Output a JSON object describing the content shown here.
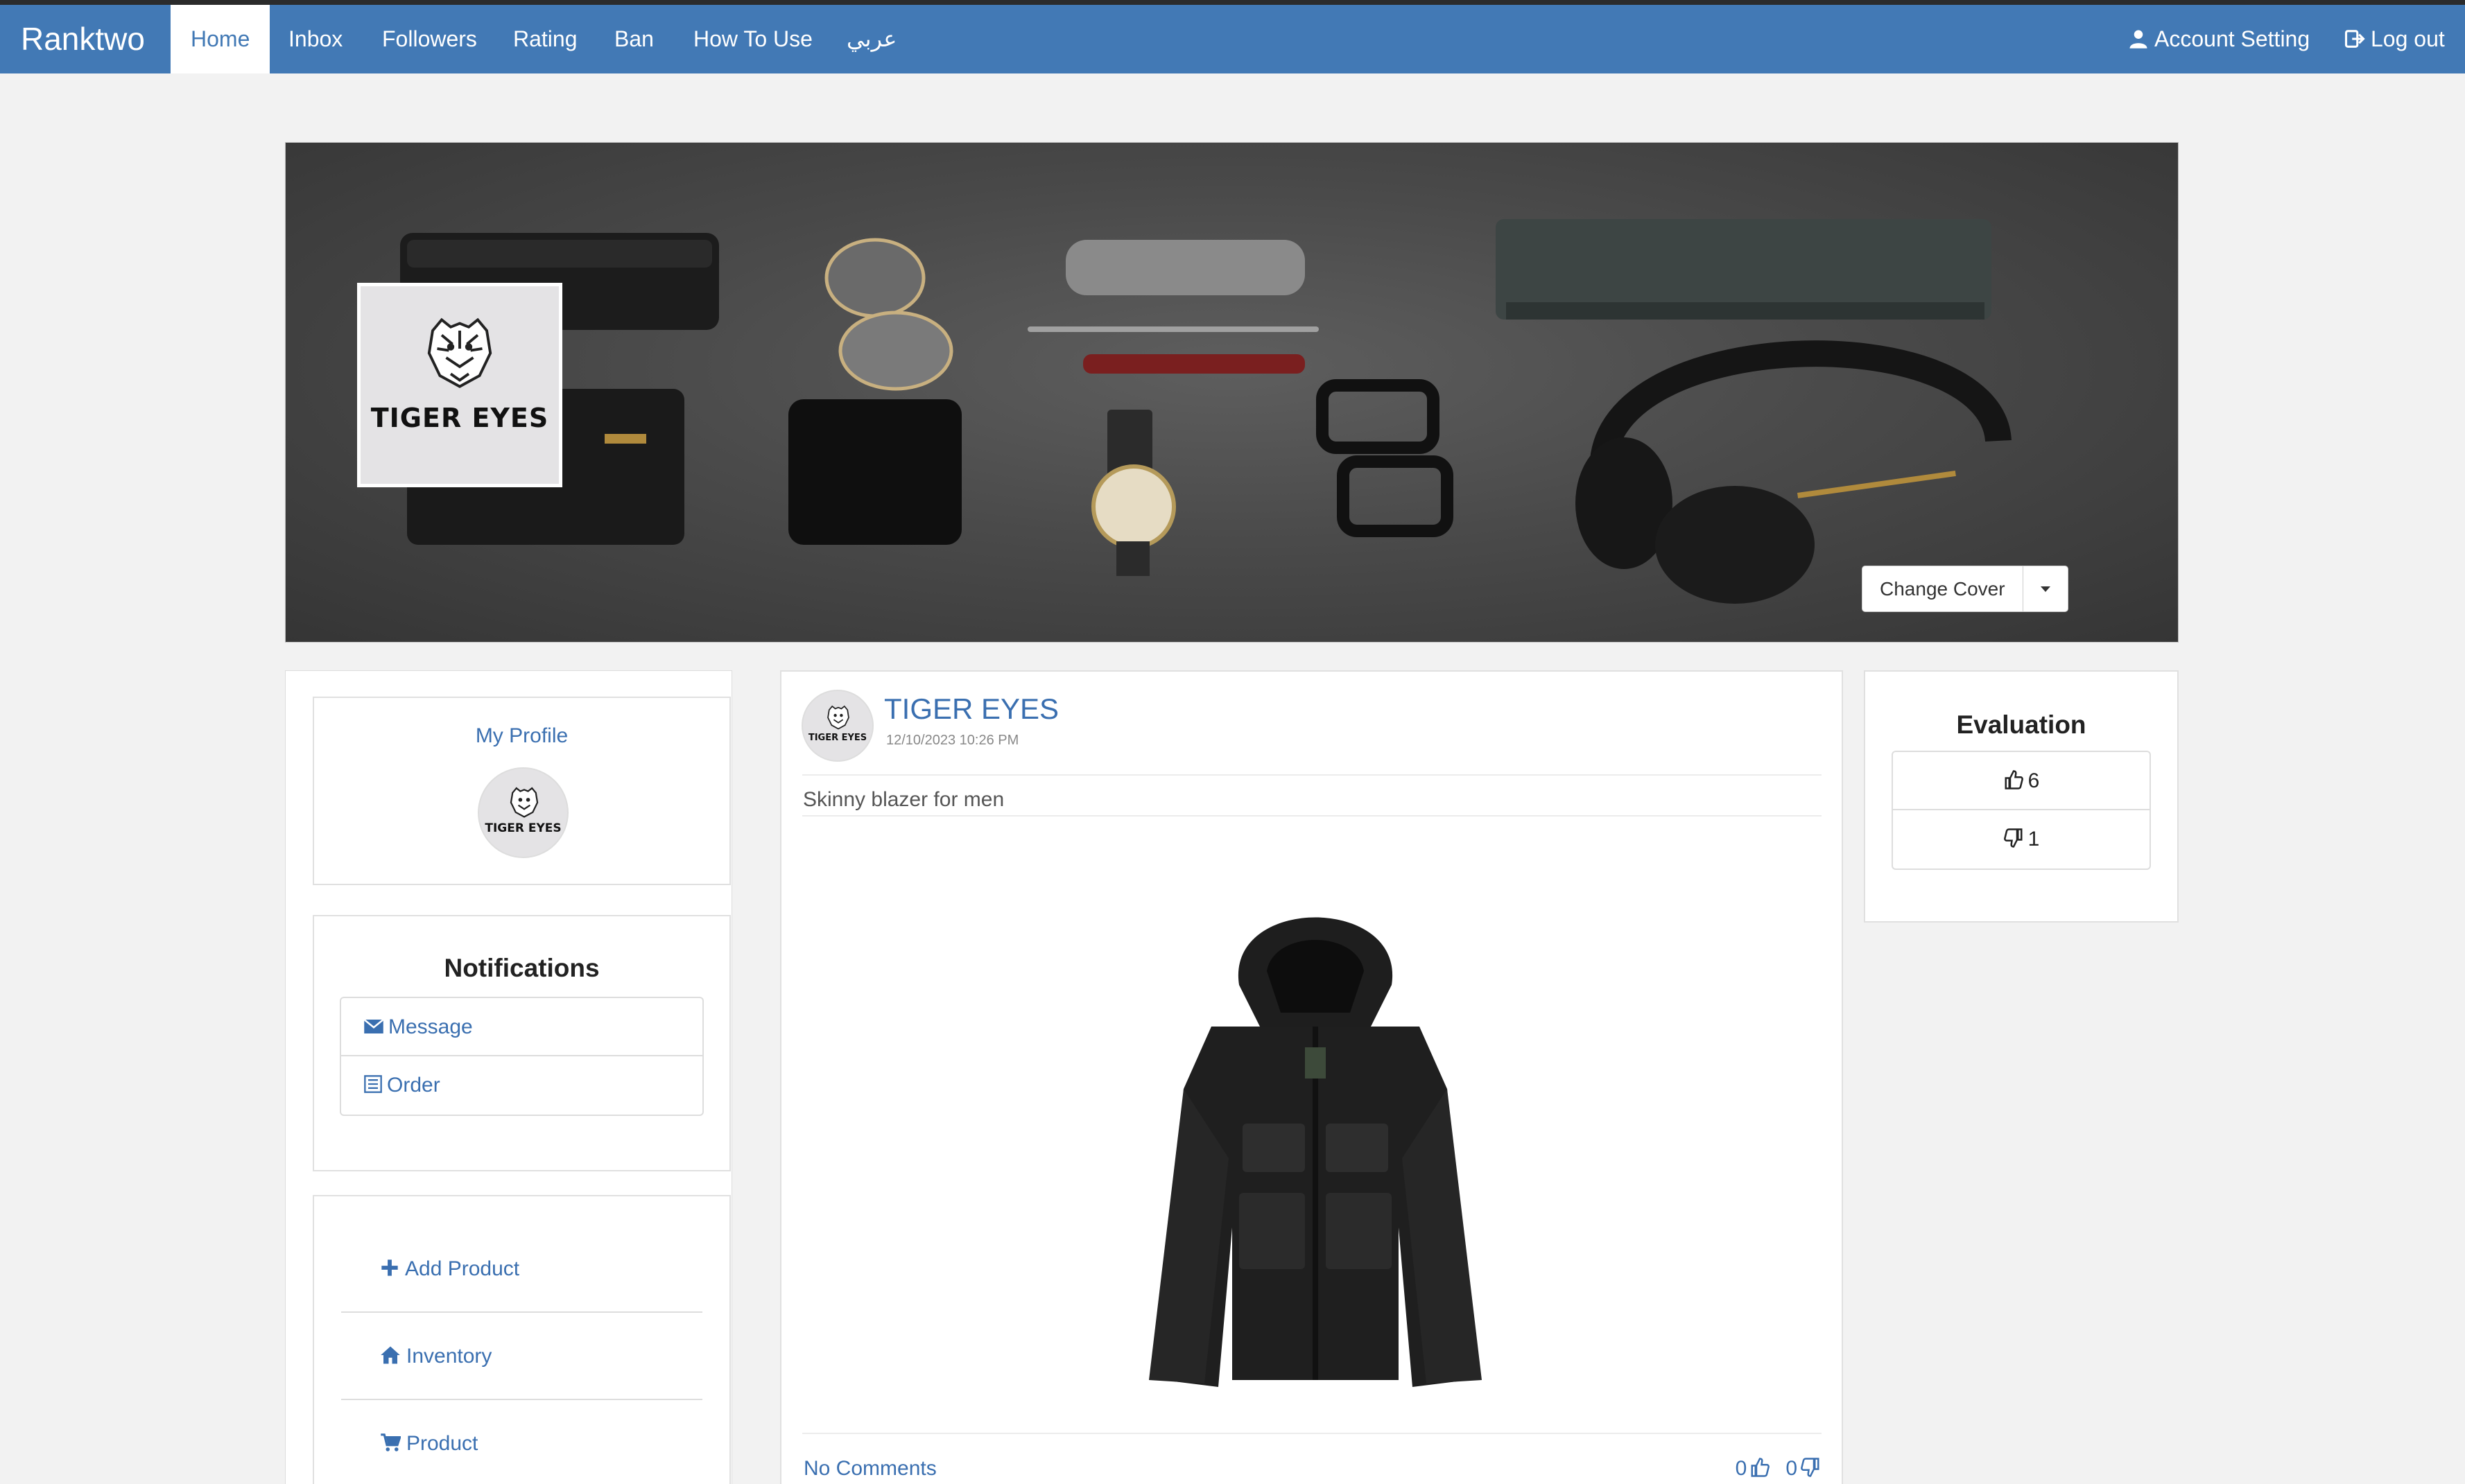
{
  "navbar": {
    "brand": "Ranktwo",
    "items": [
      {
        "label": "Home",
        "active": true
      },
      {
        "label": "Inbox"
      },
      {
        "label": "Followers"
      },
      {
        "label": "Rating"
      },
      {
        "label": "Ban"
      },
      {
        "label": "How To Use"
      },
      {
        "label": "عربي"
      }
    ],
    "account_setting": "Account Setting",
    "logout": "Log out",
    "accent_color": "#4279b5"
  },
  "cover": {
    "logo_text": "TIGER EYES",
    "change_cover_label": "Change Cover"
  },
  "sidebar": {
    "profile_title": "My Profile",
    "avatar_text": "TIGER EYES",
    "notifications": {
      "title": "Notifications",
      "items": [
        {
          "label": "Message",
          "icon": "envelope-icon"
        },
        {
          "label": "Order",
          "icon": "list-icon"
        }
      ]
    },
    "actions": [
      {
        "label": "Add Product",
        "icon": "plus-icon"
      },
      {
        "label": "Inventory",
        "icon": "home-icon"
      },
      {
        "label": "Product",
        "icon": "cart-icon"
      }
    ]
  },
  "post": {
    "author": "TIGER EYES",
    "avatar_text": "TIGER EYES",
    "timestamp": "12/10/2023 10:26 PM",
    "text": "Skinny blazer for men",
    "comments_label": "No Comments",
    "likes": "0",
    "dislikes": "0"
  },
  "evaluation": {
    "title": "Evaluation",
    "likes": "6",
    "dislikes": "1"
  }
}
